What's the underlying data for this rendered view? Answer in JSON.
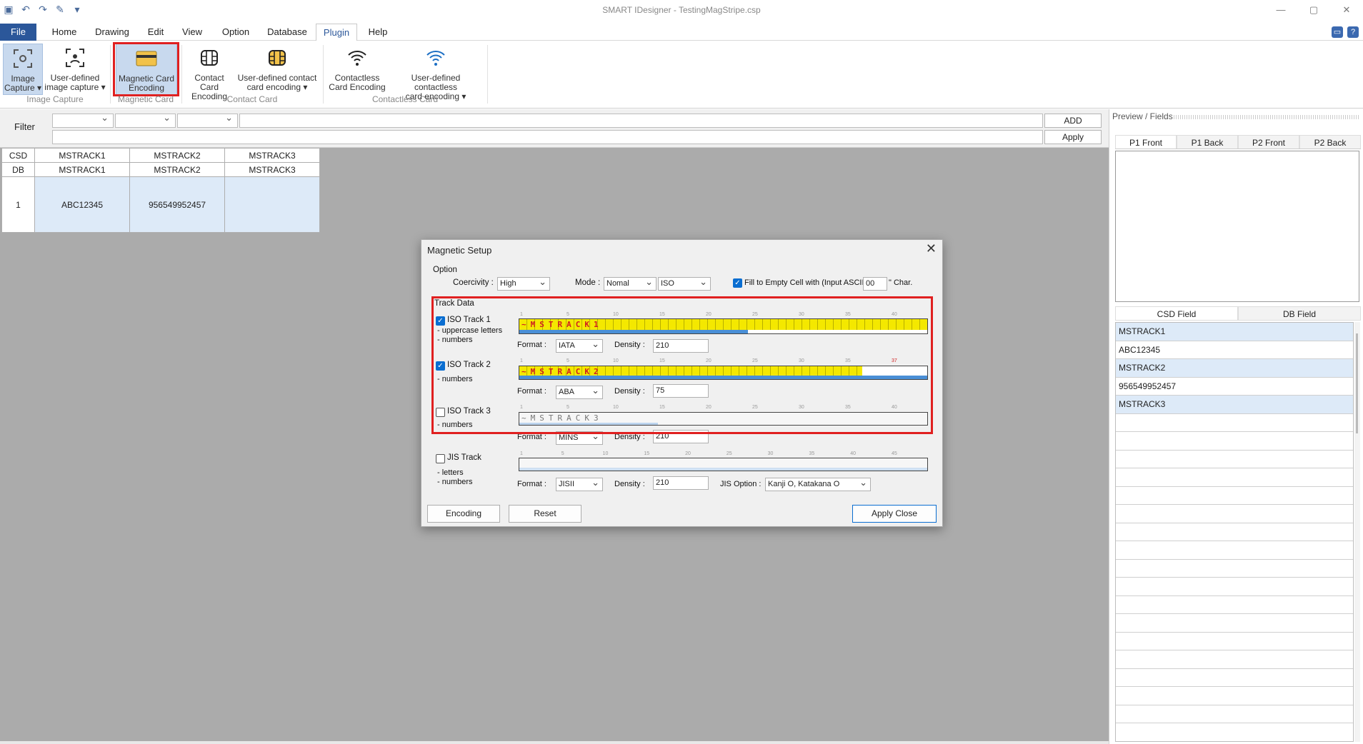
{
  "window": {
    "title": "SMART IDesigner - TestingMagStripe.csp",
    "controls": [
      "—",
      "▢",
      "✕"
    ]
  },
  "menu": {
    "file": "File",
    "tabs": [
      "Home",
      "Drawing",
      "Edit",
      "View",
      "Option",
      "Database",
      "Plugin",
      "Help"
    ],
    "active": "Plugin"
  },
  "ribbon": {
    "buttons": [
      {
        "label1": "Image",
        "label2": "Capture ▾",
        "icon": "image-capture-icon"
      },
      {
        "label1": "User-defined",
        "label2": "image capture ▾",
        "icon": "user-image-capture-icon"
      },
      {
        "label1": "Magnetic Card",
        "label2": "Encoding",
        "icon": "magnetic-card-icon"
      },
      {
        "label1": "Contact Card",
        "label2": "Encoding",
        "icon": "contact-card-icon"
      },
      {
        "label1": "User-defined contact",
        "label2": "card encoding ▾",
        "icon": "user-contact-card-icon"
      },
      {
        "label1": "Contactless",
        "label2": "Card Encoding",
        "icon": "contactless-icon"
      },
      {
        "label1": "User-defined contactless",
        "label2": "card encoding ▾",
        "icon": "user-contactless-icon"
      }
    ],
    "groups": [
      "Image Capture",
      "Magnetic Card",
      "Contact Card",
      "Contactless Card"
    ]
  },
  "filter": {
    "label": "Filter",
    "add": "ADD",
    "apply": "Apply"
  },
  "grid": {
    "rows": [
      [
        "CSD",
        "MSTRACK1",
        "MSTRACK2",
        "MSTRACK3"
      ],
      [
        "DB",
        "MSTRACK1",
        "MSTRACK2",
        "MSTRACK3"
      ]
    ],
    "data": [
      "1",
      "ABC12345",
      "956549952457",
      ""
    ]
  },
  "rightpanel": {
    "header": "Preview / Fields",
    "preview_tabs": [
      "P1 Front",
      "P1 Back",
      "P2 Front",
      "P2 Back"
    ],
    "field_tabs": [
      "CSD Field",
      "DB Field"
    ],
    "fields": [
      "MSTRACK1",
      "ABC12345",
      "MSTRACK2",
      "956549952457",
      "MSTRACK3",
      ""
    ]
  },
  "dialog": {
    "title": "Magnetic Setup",
    "option_label": "Option",
    "coercivity_label": "Coercivity :",
    "coercivity": "High",
    "mode_label": "Mode :",
    "mode": "Nomal",
    "mode2": "ISO",
    "fill_label": "Fill to Empty Cell with (Input ASCII)",
    "fill_value": "00",
    "char_label": "\" Char.",
    "track_data_label": "Track Data",
    "format_label": "Format :",
    "density_label": "Density :",
    "tracks": [
      {
        "name": "ISO Track 1",
        "checked": true,
        "desc1": "- uppercase letters",
        "desc2": "- numbers",
        "bar": "~MSTRACK1",
        "format": "IATA",
        "density": "210",
        "ruler": [
          "1",
          "5",
          "10",
          "15",
          "20",
          "25",
          "30",
          "35",
          "40"
        ]
      },
      {
        "name": "ISO Track 2",
        "checked": true,
        "desc1": "- numbers",
        "desc2": "",
        "bar": "~MSTRACK2",
        "format": "ABA",
        "density": "75",
        "ruler": [
          "1",
          "5",
          "10",
          "15",
          "20",
          "25",
          "30",
          "35",
          "37"
        ]
      },
      {
        "name": "ISO Track 3",
        "checked": false,
        "desc1": "- numbers",
        "desc2": "",
        "bar": "~MSTRACK3",
        "format": "MINS",
        "density": "210",
        "ruler": [
          "1",
          "5",
          "10",
          "15",
          "20",
          "25",
          "30",
          "35",
          "40"
        ]
      },
      {
        "name": "JIS Track",
        "checked": false,
        "desc1": "- letters",
        "desc2": "- numbers",
        "bar": "",
        "format": "JISII",
        "density": "210",
        "ruler": [
          "1",
          "5",
          "10",
          "15",
          "20",
          "25",
          "30",
          "35",
          "40",
          "45"
        ]
      }
    ],
    "jis_option_label": "JIS Option :",
    "jis_option": "Kanji O, Katakana O",
    "buttons": {
      "encoding": "Encoding",
      "reset": "Reset",
      "apply_close": "Apply  Close"
    }
  },
  "colors": {
    "accent": "#2b579a",
    "highlight": "#e02020",
    "track_fill": "#f4e800"
  }
}
